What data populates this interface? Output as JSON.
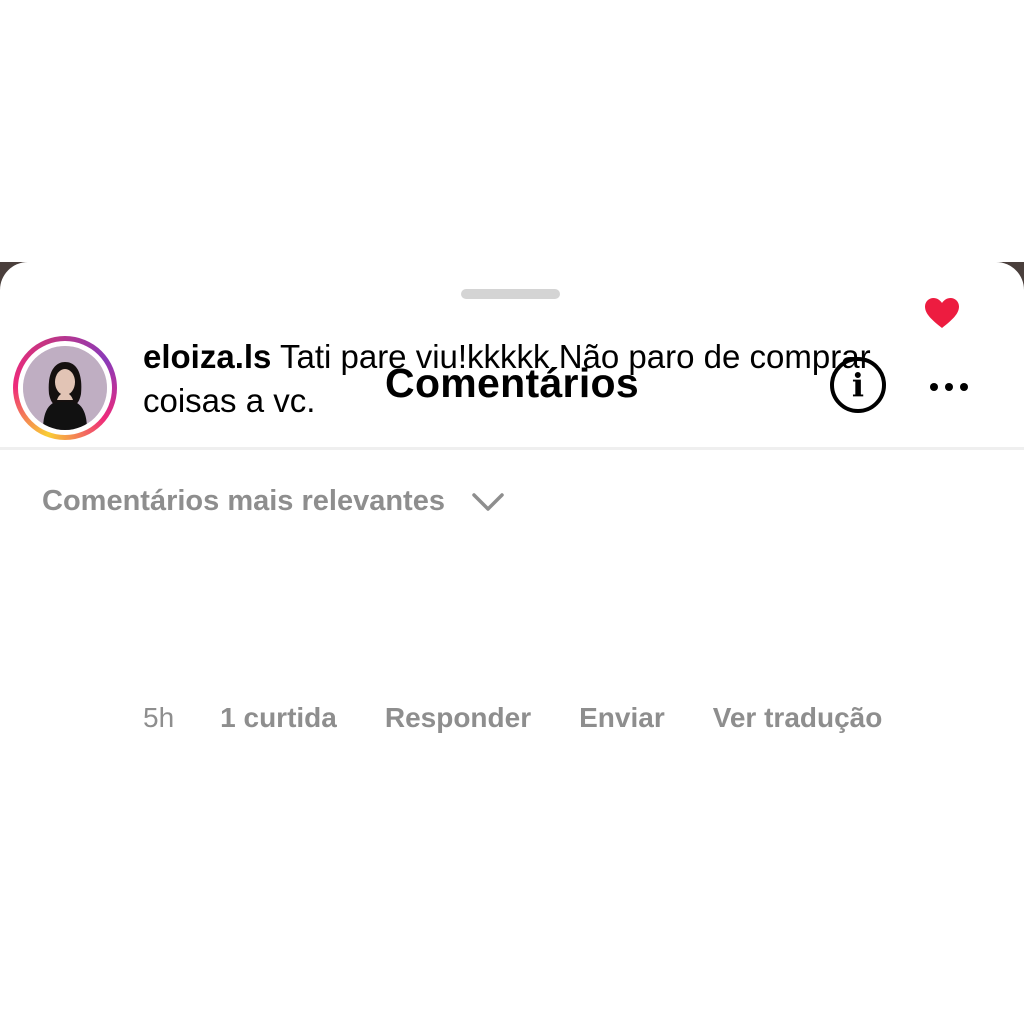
{
  "sheet": {
    "title": "Comentários",
    "info_icon": "info-circle-icon",
    "more_icon": "more-horizontal-icon"
  },
  "sort": {
    "label": "Comentários mais relevantes",
    "icon": "chevron-down-icon"
  },
  "comment": {
    "username": "eloiza.ls",
    "text": "Tati pare viu!kkkkk Não paro de comprar coisas a vc.",
    "time": "5h",
    "likes": "1 curtida",
    "reply_label": "Responder",
    "send_label": "Enviar",
    "translate_label": "Ver tradução",
    "liked": true,
    "heart_color": "#ed1c40"
  },
  "colors": {
    "secondary_text": "#8e8e8e",
    "story_ring": [
      "#f9ce34",
      "#ee2a7b",
      "#8a3ab9"
    ]
  }
}
